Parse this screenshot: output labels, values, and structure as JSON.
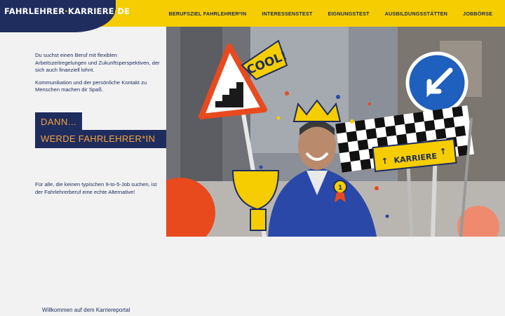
{
  "logo": {
    "part1": "FAHRLEHRER",
    "part2": "KARRIERE",
    "part3": "DE"
  },
  "nav": [
    "BERUFSZIEL FAHRLEHRER*IN",
    "INTERESSENSTEST",
    "EIGNUNGSTEST",
    "AUSBILDUNGSSTÄTTEN",
    "JOBBÖRSE"
  ],
  "intro": {
    "p1": "Du suchst einen Beruf mit flexiblen Arbeitszeitregelungen und Zukunftsperspektiven, der sich auch finanziell lohnt.",
    "p2": "Kommunikation und der persönliche Kontakt zu Menschen machen dir Spaß."
  },
  "headline": {
    "line1": "DANN...",
    "line2": "WERDE FAHRLEHRER*IN"
  },
  "alternative": "Für alle, die keinen typischen 9-to-5-Job suchen, ist der Fahrlehrerberuf eine echte Alternative!",
  "welcome": "Willkommen auf dem Karriereportal",
  "hero": {
    "cool_text": "COOL!",
    "sign_text": "KARRIERE",
    "badge_number": "1"
  },
  "colors": {
    "yellow": "#f5cd00",
    "navy": "#1f2d5e",
    "orange": "#f5a33b"
  }
}
